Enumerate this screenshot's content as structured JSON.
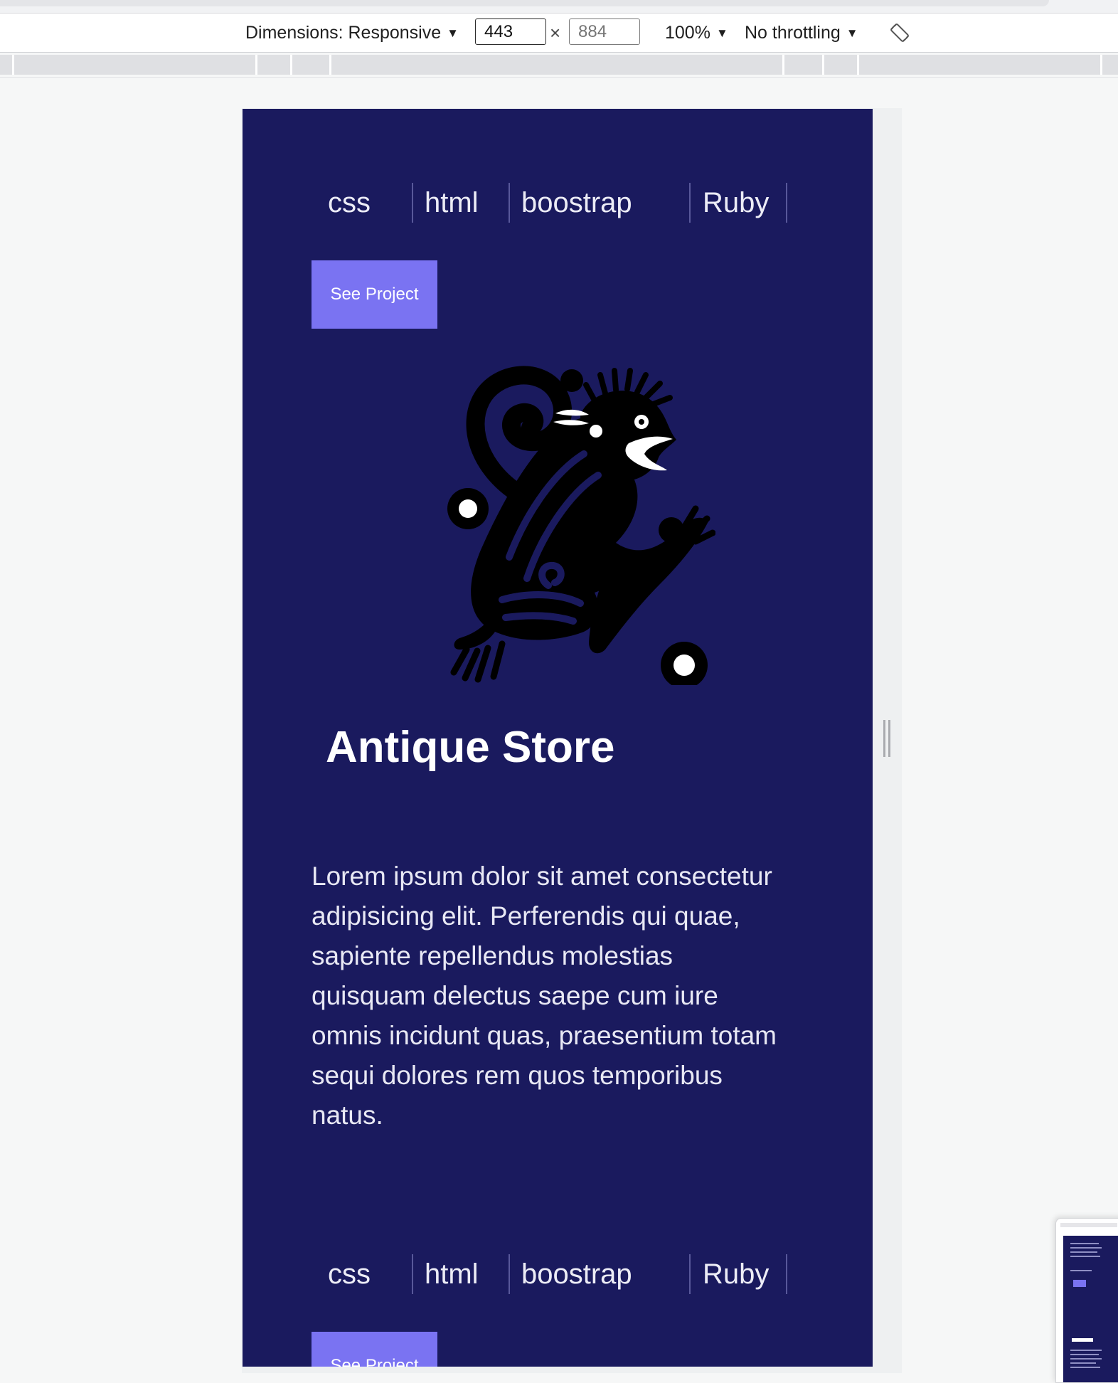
{
  "devtools": {
    "dimensions_label": "Dimensions: Responsive",
    "width_value": "443",
    "height_placeholder": "884",
    "times_symbol": "×",
    "zoom_label": "100%",
    "throttle_label": "No throttling",
    "caret": "▼",
    "rotate_icon": "rotate-icon"
  },
  "page": {
    "background": "#1a1a5e",
    "accent": "#7a73f2",
    "projects": [
      {
        "tags": [
          "css",
          "html",
          "boostrap",
          "Ruby"
        ],
        "button_label": "See Project",
        "image_icon": "tribal-monkey-icon",
        "title": "Antique Store",
        "description": "Lorem ipsum dolor sit amet consectetur adipisicing elit. Perferendis qui quae, sapiente repellendus molestias quisquam delectus saepe cum iure omnis incidunt quas, praesentium totam sequi dolores rem quos temporibus natus."
      },
      {
        "tags": [
          "css",
          "html",
          "boostrap",
          "Ruby"
        ],
        "button_label": "See Project"
      }
    ]
  }
}
